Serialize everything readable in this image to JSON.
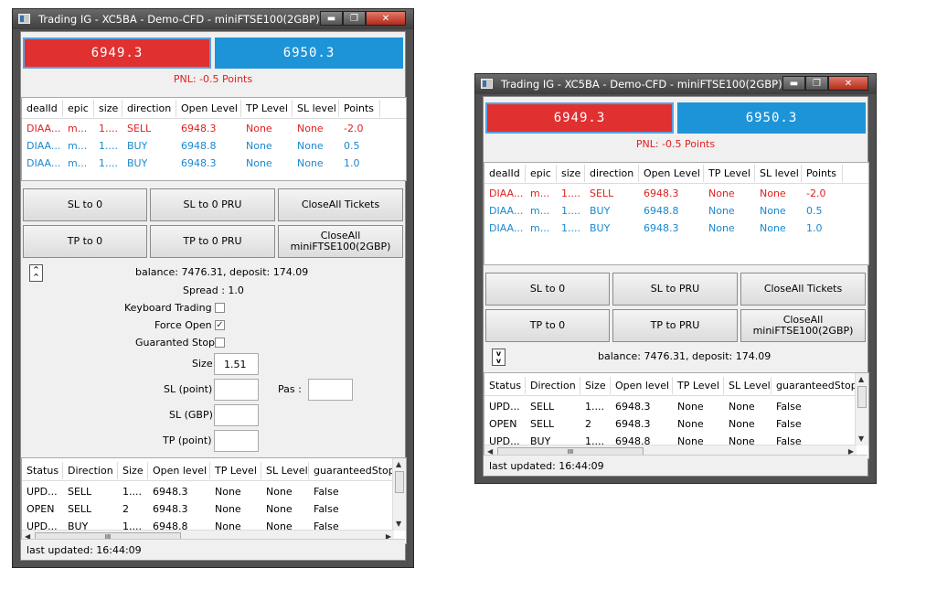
{
  "title": "Trading IG - XC5BA - Demo-CFD - miniFTSE100(2GBP)",
  "window_buttons": {
    "minimize": "▬",
    "maximize": "❐",
    "close": "✕"
  },
  "bid": "6949.3",
  "ask": "6950.3",
  "pnl": "PNL: -0.5 Points",
  "deals": {
    "headers_left": [
      "dealId",
      "epic",
      "size",
      "direction",
      "Open Level",
      "TP Level",
      "SL level",
      "Points"
    ],
    "headers_right": [
      "dealId",
      "epic",
      "size",
      "direction",
      "Open Level",
      "TP Level",
      "SL level",
      "Points"
    ],
    "rows": [
      {
        "cells": [
          "DIAA...",
          "m...",
          "1....",
          "SELL",
          "6948.3",
          "None",
          "None",
          "-2.0"
        ],
        "color": "red"
      },
      {
        "cells": [
          "DIAA...",
          "m...",
          "1....",
          "BUY",
          "6948.8",
          "None",
          "None",
          "0.5"
        ],
        "color": "blue"
      },
      {
        "cells": [
          "DIAA...",
          "m...",
          "1....",
          "BUY",
          "6948.3",
          "None",
          "None",
          "1.0"
        ],
        "color": "blue"
      }
    ]
  },
  "buttons_left": {
    "sl_to_0": "SL to 0",
    "sl_to_0_pru": "SL to 0  PRU",
    "close_all": "CloseAll Tickets",
    "tp_to_0": "TP  to 0",
    "tp_to_0_pru": "TP to 0  PRU",
    "close_all_market": "CloseAll miniFTSE100(2GBP)"
  },
  "buttons_right": {
    "sl_to_0": "SL to 0",
    "sl_to_pru": "SL to  PRU",
    "close_all": "CloseAll Tickets",
    "tp_to_0": "TP  to 0",
    "tp_to_pru": "TP to  PRU",
    "close_all_market": "CloseAll miniFTSE100(2GBP)"
  },
  "toggle_left": "^\n^",
  "toggle_right": "v\nv",
  "balance": "balance: 7476.31, deposit: 174.09",
  "spread": "Spread : 1.0",
  "keyboard_trading": "Keyboard Trading",
  "force_open": "Force Open",
  "force_open_checked": "✓",
  "guaranteed_stop": "Guaranted Stop",
  "size_label": "Size",
  "size_value": "1.51",
  "sl_point_label": "SL (point)",
  "pas_label": "Pas :",
  "sl_gbp_label": "SL (GBP)",
  "tp_point_label": "TP (point)",
  "positions": {
    "headers": [
      "Status",
      "Direction",
      "Size",
      "Open level",
      "TP Level",
      "SL Level",
      "guaranteedStop"
    ],
    "rows": [
      [
        "UPD...",
        "SELL",
        "1....",
        "6948.3",
        "None",
        "None",
        "False"
      ],
      [
        "OPEN",
        "SELL",
        "2",
        "6948.3",
        "None",
        "None",
        "False"
      ],
      [
        "UPD...",
        "BUY",
        "1....",
        "6948.8",
        "None",
        "None",
        "False"
      ]
    ]
  },
  "scroll_glyph": "III",
  "last_updated": "last updated: 16:44:09"
}
